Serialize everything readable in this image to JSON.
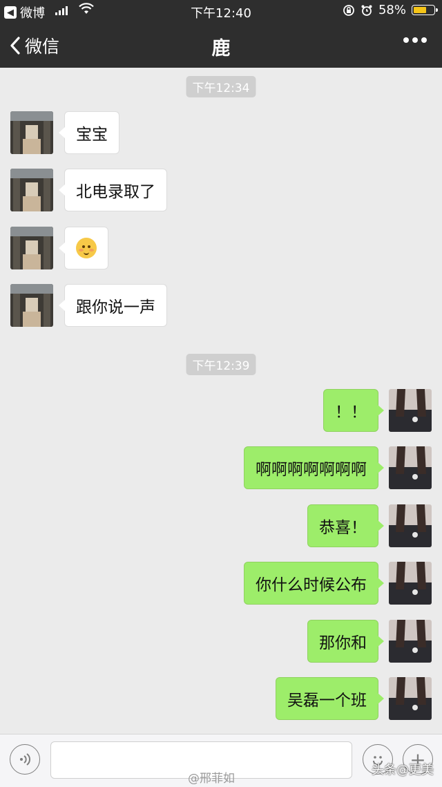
{
  "status_bar": {
    "back_app": "微博",
    "time": "下午12:40",
    "battery_percent": "58%",
    "battery_level": 0.58
  },
  "nav": {
    "back_label": "微信",
    "title": "鹿"
  },
  "timestamps": [
    "下午12:34",
    "下午12:39"
  ],
  "messages": [
    {
      "side": "left",
      "text": "宝宝"
    },
    {
      "side": "left",
      "text": "北电录取了"
    },
    {
      "side": "left",
      "emoji": "smiling-blush-emoji"
    },
    {
      "side": "left",
      "text": "跟你说一声"
    },
    {
      "side": "right",
      "text": "！！"
    },
    {
      "side": "right",
      "text": "啊啊啊啊啊啊啊"
    },
    {
      "side": "right",
      "text": "恭喜！"
    },
    {
      "side": "right",
      "text": "你什么时候公布"
    },
    {
      "side": "right",
      "text": "那你和"
    },
    {
      "side": "right",
      "text": "吴磊一个班"
    }
  ],
  "watermarks": {
    "weibo": "@邢菲如",
    "toutiao": "头条@更美"
  },
  "colors": {
    "bubble_right": "#9ded6a",
    "bubble_left": "#ffffff",
    "topbar": "#2e2e2e",
    "chat_background": "#ebebeb"
  }
}
